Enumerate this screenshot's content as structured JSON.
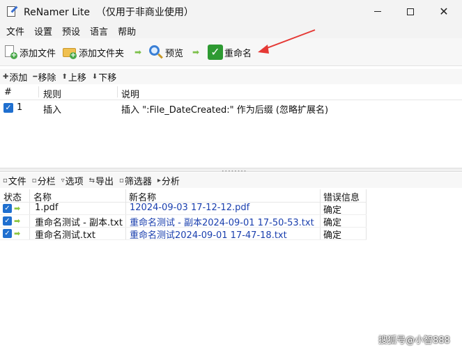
{
  "window": {
    "title": "ReNamer Lite  （仅用于非商业使用）",
    "controls": {
      "minimize": "minimize-icon",
      "maximize": "maximize-icon",
      "close": "✕"
    }
  },
  "menu": [
    "文件",
    "设置",
    "预设",
    "语言",
    "帮助"
  ],
  "toolbar": {
    "add_files": "添加文件",
    "add_folders": "添加文件夹",
    "preview": "预览",
    "rename": "重命名",
    "icons": [
      "add-file-icon",
      "add-folder-icon",
      "magnifier-icon",
      "checkmark-icon"
    ]
  },
  "rules_bar": [
    {
      "glyph": "✚",
      "label": "添加"
    },
    {
      "glyph": "━",
      "label": "移除"
    },
    {
      "glyph": "⬆",
      "label": "上移"
    },
    {
      "glyph": "⬇",
      "label": "下移"
    }
  ],
  "rules_table": {
    "headers": [
      "#",
      "规则",
      "说明"
    ],
    "rows": [
      {
        "checked": true,
        "index": "1",
        "rule": "插入",
        "description": "插入 \":File_DateCreated:\" 作为后缀 (忽略扩展名)"
      }
    ]
  },
  "files_bar": [
    {
      "glyph": "▫",
      "label": "文件"
    },
    {
      "glyph": "▫",
      "label": "分栏"
    },
    {
      "glyph": "▿",
      "label": "选项"
    },
    {
      "glyph": "⇆",
      "label": "导出"
    },
    {
      "glyph": "▫",
      "label": "筛选器"
    },
    {
      "glyph": "▸",
      "label": "分析"
    }
  ],
  "files_table": {
    "headers": [
      "状态",
      "名称",
      "新名称",
      "错误信息"
    ],
    "rows": [
      {
        "checked": true,
        "name": "1.pdf",
        "new_name": "12024-09-03 17-12-12.pdf",
        "status": "确定"
      },
      {
        "checked": true,
        "name": "重命名测试 - 副本.txt",
        "new_name": "重命名测试 - 副本2024-09-01 17-50-53.txt",
        "status": "确定"
      },
      {
        "checked": true,
        "name": "重命名测试.txt",
        "new_name": "重命名测试2024-09-01 17-47-18.txt",
        "status": "确定"
      }
    ]
  },
  "watermark": "搜狐号@小智888",
  "colors": {
    "accent": "#1f6fcf",
    "new_name_text": "#1a3fae",
    "annotation": "#e53935",
    "rename_icon": "#2e9a32"
  }
}
